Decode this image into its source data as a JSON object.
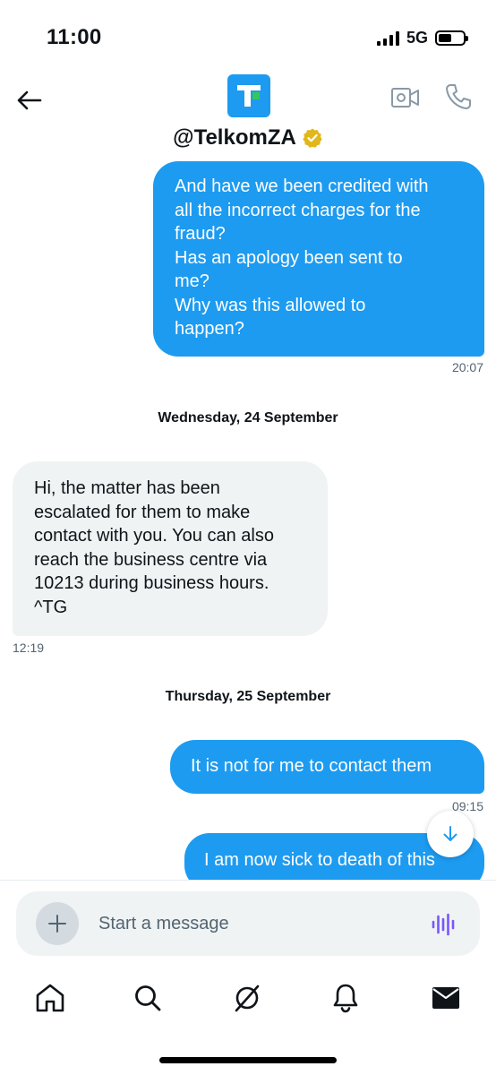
{
  "status_bar": {
    "time": "11:00",
    "network": "5G",
    "battery_level": 0.55,
    "signal_bars": 4
  },
  "header": {
    "handle": "@TelkomZA",
    "verified": true,
    "avatar_letter": "T",
    "icons": [
      "back-arrow-icon",
      "video-camera-icon",
      "phone-icon",
      "verified-badge-icon"
    ]
  },
  "messages": [
    {
      "direction": "outgoing",
      "lines": [
        "And have we been credited with",
        "all the incorrect charges for the",
        "fraud?",
        "Has an apology been sent to",
        "me?",
        "Why was this allowed to",
        "happen?"
      ],
      "time": "20:07"
    },
    {
      "direction": "incoming",
      "date_separator": "Wednesday, 24 September",
      "lines": [
        "Hi, the matter has been",
        "escalated for them to make",
        "contact with you. You can also",
        "reach the business centre  via",
        "10213 during business hours.",
        "^TG"
      ],
      "time": "12:19"
    },
    {
      "direction": "outgoing",
      "date_separator": "Thursday, 25 September",
      "lines": [
        "It is not for me to contact them"
      ],
      "time": "09:15"
    },
    {
      "direction": "outgoing",
      "lines": [
        "I am now sick to death of this"
      ],
      "time": ""
    }
  ],
  "composer": {
    "placeholder": "Start a message",
    "icons": [
      "plus-icon",
      "voice-wave-icon"
    ]
  },
  "tab_bar": {
    "items": [
      {
        "name": "home",
        "icon": "home-icon"
      },
      {
        "name": "search",
        "icon": "search-icon"
      },
      {
        "name": "grok",
        "icon": "grok-icon"
      },
      {
        "name": "notifications",
        "icon": "bell-icon"
      },
      {
        "name": "messages",
        "icon": "envelope-icon",
        "active": true
      }
    ]
  },
  "colors": {
    "accent": "#1d9bf0",
    "incoming_bubble": "#eff3f4",
    "muted_text": "#536471",
    "verified_gold": "#e2b719",
    "voice_purple": "#7856ff"
  }
}
